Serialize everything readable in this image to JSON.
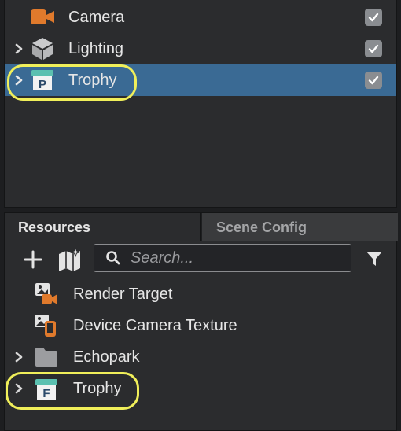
{
  "scene": {
    "items": [
      {
        "label": "Camera",
        "icon": "camera-icon",
        "checked": true,
        "expandable": false,
        "selected": false
      },
      {
        "label": "Lighting",
        "icon": "lighting-icon",
        "checked": true,
        "expandable": true,
        "selected": false
      },
      {
        "label": "Trophy",
        "icon": "prefab-icon",
        "checked": true,
        "expandable": true,
        "selected": true
      }
    ]
  },
  "resources": {
    "tabs": [
      {
        "label": "Resources",
        "active": true
      },
      {
        "label": "Scene Config",
        "active": false
      }
    ],
    "search_placeholder": "Search...",
    "items": [
      {
        "label": "Render Target",
        "icon": "render-target-icon",
        "expandable": false
      },
      {
        "label": "Device Camera Texture",
        "icon": "device-camera-texture-icon",
        "expandable": false
      },
      {
        "label": "Echopark",
        "icon": "folder-icon",
        "expandable": true
      },
      {
        "label": "Trophy",
        "icon": "prefab-asset-icon",
        "expandable": true
      }
    ]
  },
  "colors": {
    "selection": "#3a6a94",
    "highlight_outline": "#f0ef5a",
    "orange_accent": "#e07a2c",
    "teal_accent": "#5bc0b0"
  }
}
